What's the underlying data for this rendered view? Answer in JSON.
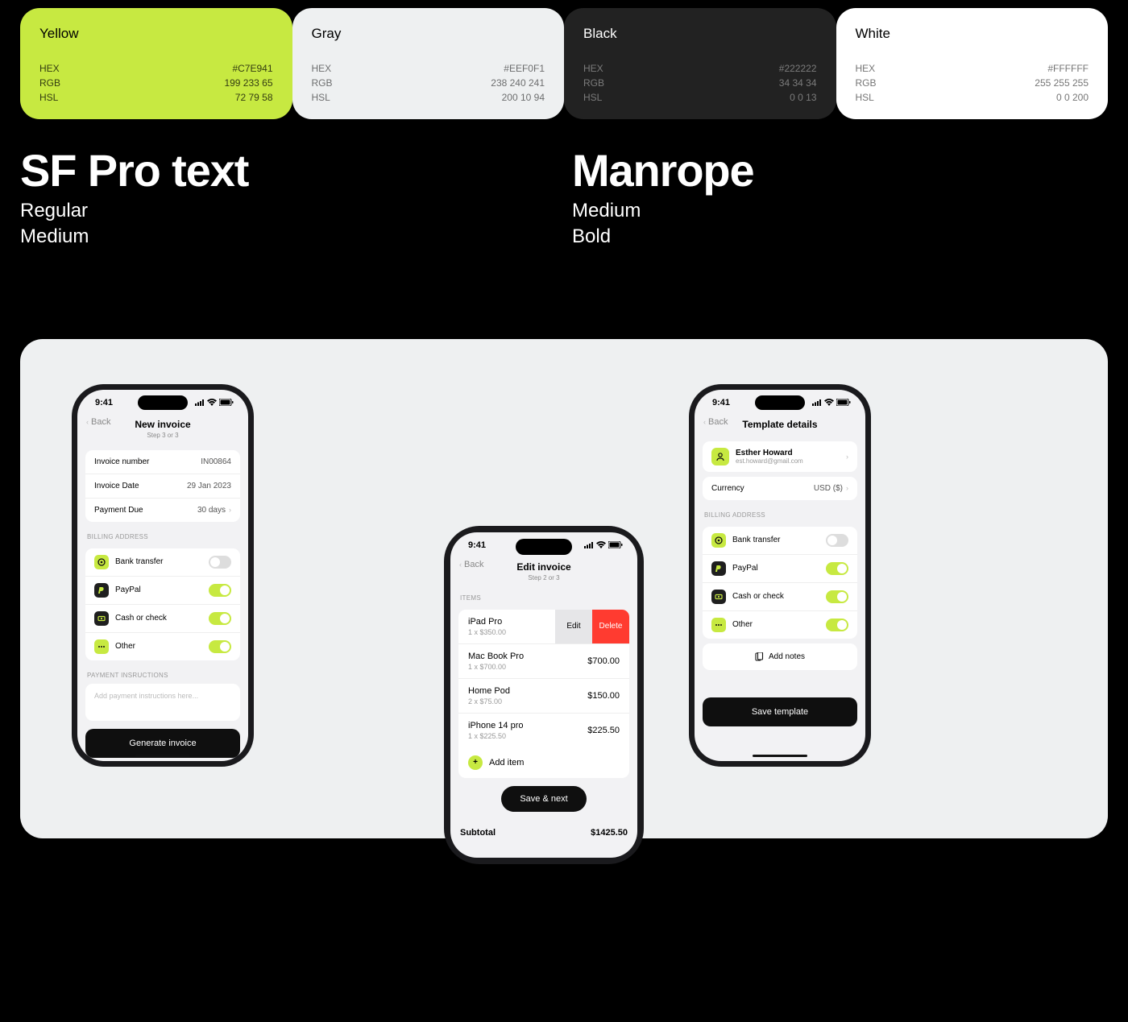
{
  "swatches": [
    {
      "name": "Yellow",
      "hex": "#C7E941",
      "rgb": "199 233 65",
      "hsl": "72 79 58"
    },
    {
      "name": "Gray",
      "hex": "#EEF0F1",
      "rgb": "238 240 241",
      "hsl": "200 10 94"
    },
    {
      "name": "Black",
      "hex": "#222222",
      "rgb": "34 34 34",
      "hsl": "0 0 13"
    },
    {
      "name": "White",
      "hex": "#FFFFFF",
      "rgb": "255 255 255",
      "hsl": "0 0 200"
    }
  ],
  "swatch_keys": {
    "hex": "HEX",
    "rgb": "RGB",
    "hsl": "HSL"
  },
  "fonts": [
    {
      "name": "SF Pro text",
      "weights": [
        "Regular",
        "Medium"
      ]
    },
    {
      "name": "Manrope",
      "weights": [
        "Medium",
        "Bold"
      ]
    }
  ],
  "statusbar": {
    "time": "9:41"
  },
  "phone1": {
    "back": "Back",
    "title": "New invoice",
    "subtitle": "Step 3 or 3",
    "rows": [
      {
        "label": "Invoice number",
        "value": "IN00864",
        "chevron": false
      },
      {
        "label": "Invoice Date",
        "value": "29 Jan 2023",
        "chevron": false
      },
      {
        "label": "Payment Due",
        "value": "30 days",
        "chevron": true
      }
    ],
    "section_billing": "BILLING ADDRESS",
    "payments": [
      {
        "icon": "bank",
        "label": "Bank transfer",
        "on": false
      },
      {
        "icon": "paypal",
        "label": "PayPal",
        "on": true
      },
      {
        "icon": "cash",
        "label": "Cash or check",
        "on": true
      },
      {
        "icon": "other",
        "label": "Other",
        "on": true
      }
    ],
    "section_instr": "PAYMENT INSRUCTIONS",
    "instr_placeholder": "Add payment instructions here...",
    "cta": "Generate invoice"
  },
  "phone2": {
    "back": "Back",
    "title": "Edit invoice",
    "subtitle": "Step 2 or 3",
    "section_items": "ITEMS",
    "items": [
      {
        "name": "iPad Pro",
        "sub": "1 x $350.00",
        "price": "",
        "edit": "Edit",
        "del": "Delete",
        "swipe": true
      },
      {
        "name": "Mac Book Pro",
        "sub": "1 x $700.00",
        "price": "$700.00",
        "swipe": false
      },
      {
        "name": "Home Pod",
        "sub": "2 x $75.00",
        "price": "$150.00",
        "swipe": false
      },
      {
        "name": "iPhone 14 pro",
        "sub": "1 x $225.50",
        "price": "$225.50",
        "swipe": false
      }
    ],
    "add_item": "Add item",
    "cta": "Save & next",
    "subtotal_label": "Subtotal",
    "subtotal_value": "$1425.50"
  },
  "phone3": {
    "back": "Back",
    "title": "Template details",
    "contact": {
      "name": "Esther Howard",
      "email": "est.howard@gmail.com"
    },
    "currency": {
      "label": "Currency",
      "value": "USD ($)"
    },
    "section_billing": "BILLING ADDRESS",
    "payments": [
      {
        "icon": "bank",
        "label": "Bank transfer",
        "on": false
      },
      {
        "icon": "paypal",
        "label": "PayPal",
        "on": true
      },
      {
        "icon": "cash",
        "label": "Cash or check",
        "on": true
      },
      {
        "icon": "other",
        "label": "Other",
        "on": true
      }
    ],
    "add_notes": "Add notes",
    "cta": "Save template"
  }
}
